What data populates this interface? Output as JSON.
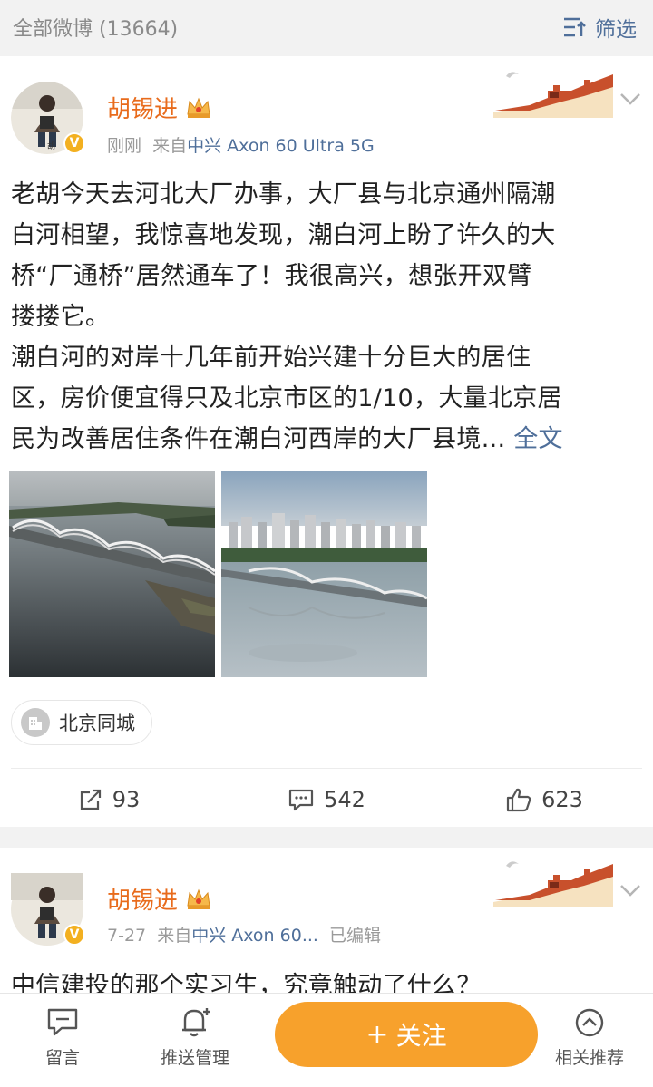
{
  "header": {
    "all_posts": "全部微博 (13664)",
    "filter": "筛选"
  },
  "post1": {
    "username": "胡锡进",
    "time": "刚刚",
    "from_prefix": "来自",
    "source": "中兴 Axon 60 Ultra 5G",
    "text_lines": [
      "老胡今天去河北大厂办事，大厂县与北京通州隔潮",
      "白河相望，我惊喜地发现，潮白河上盼了许久的大",
      "桥“厂通桥”居然通车了！我很高兴，想张开双臂",
      "搂搂它。",
      "潮白河的对岸十几年前开始兴建十分巨大的居住",
      "区，房价便宜得只及北京市区的1/10，大量北京居",
      "民为改善居住条件在潮白河西岸的大厂县境..."
    ],
    "more": "全文",
    "location_tag": "北京同城",
    "reposts": "93",
    "comments": "542",
    "likes": "623"
  },
  "post2": {
    "username": "胡锡进",
    "time": "7-27",
    "from_prefix": "来自",
    "source": "中兴 Axon 60...",
    "edited": "已编辑",
    "text_partial": "中信建投的那个实习生，究竟触动了什么？"
  },
  "bottom": {
    "message": "留言",
    "push": "推送管理",
    "follow": "关注",
    "follow_plus": "+",
    "recommend": "相关推荐"
  },
  "colors": {
    "accent_orange": "#f7a12c",
    "username_orange": "#e86b1c",
    "link_blue": "#4f6f9a"
  }
}
